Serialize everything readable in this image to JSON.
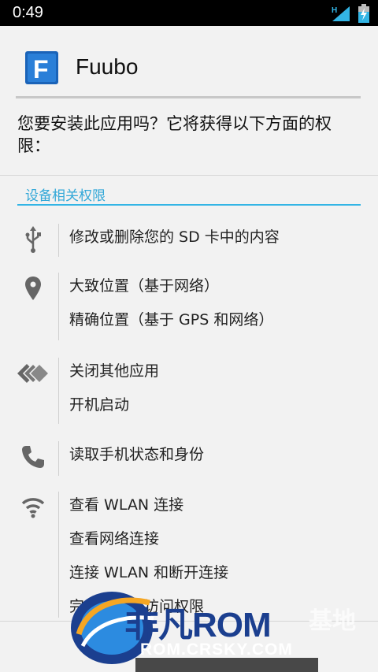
{
  "status_bar": {
    "time": "0:49",
    "network": "H"
  },
  "header": {
    "app_name": "Fuubo",
    "app_icon_letter": "F"
  },
  "prompt": "您要安装此应用吗？它将获得以下方面的权限：",
  "section": {
    "title": "设备相关权限"
  },
  "permission_groups": [
    {
      "icon": "usb-icon",
      "items": [
        "修改或删除您的 SD 卡中的内容"
      ]
    },
    {
      "icon": "location-pin-icon",
      "items": [
        "大致位置（基于网络）",
        "精确位置（基于 GPS 和网络）"
      ]
    },
    {
      "icon": "apps-stack-icon",
      "items": [
        "关闭其他应用",
        "开机启动"
      ]
    },
    {
      "icon": "phone-icon",
      "items": [
        "读取手机状态和身份"
      ]
    },
    {
      "icon": "wifi-icon",
      "items": [
        "查看 WLAN 连接",
        "查看网络连接",
        "连接 WLAN 和断开连接",
        "完全的网络访问权限"
      ]
    }
  ],
  "watermark": {
    "brand": "非凡ROM",
    "site": "ROM.CRSKY.COM",
    "suffix": "基地"
  },
  "colors": {
    "accent": "#33b5e5",
    "status_bar": "#000000",
    "background": "#f2f2f2"
  }
}
